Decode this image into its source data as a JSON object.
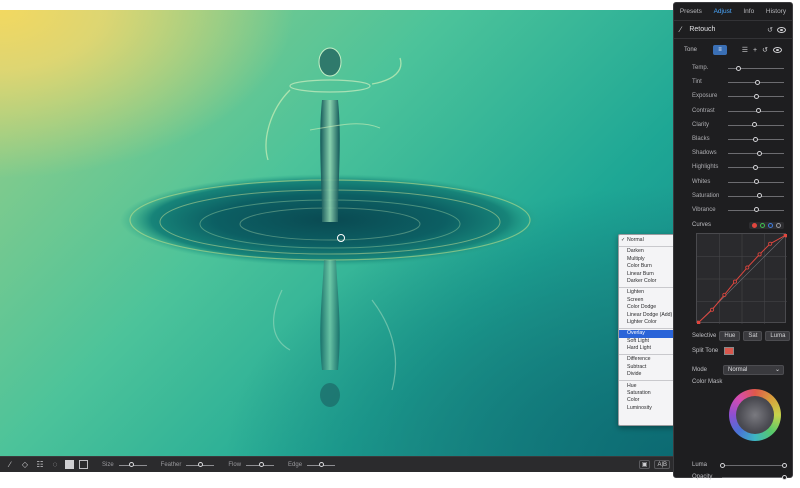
{
  "panel": {
    "tabs": [
      {
        "label": "Presets",
        "active": false
      },
      {
        "label": "Adjust",
        "active": true
      },
      {
        "label": "Info",
        "active": false
      },
      {
        "label": "History",
        "active": false
      }
    ],
    "retouch_title": "Retouch",
    "tone_label": "Tone",
    "sliders": [
      {
        "label": "Temp.",
        "value": 0.18
      },
      {
        "label": "Tint",
        "value": 0.52
      },
      {
        "label": "Exposure",
        "value": 0.5
      },
      {
        "label": "Contrast",
        "value": 0.54
      },
      {
        "label": "Clarity",
        "value": 0.48
      },
      {
        "label": "Blacks",
        "value": 0.49
      },
      {
        "label": "Shadows",
        "value": 0.57
      },
      {
        "label": "Highlights",
        "value": 0.49
      },
      {
        "label": "Whites",
        "value": 0.5
      },
      {
        "label": "Saturation",
        "value": 0.56
      },
      {
        "label": "Vibrance",
        "value": 0.5
      }
    ],
    "curves_label": "Curves",
    "curve_dot_colors": [
      "#e0463e",
      "#3fbf4f",
      "#3f7de0",
      "#9a9aa0"
    ],
    "curve_points": [
      [
        0.0,
        0.0
      ],
      [
        0.16,
        0.15
      ],
      [
        0.3,
        0.32
      ],
      [
        0.42,
        0.47
      ],
      [
        0.56,
        0.63
      ],
      [
        0.7,
        0.78
      ],
      [
        0.82,
        0.9
      ],
      [
        1.0,
        1.0
      ]
    ],
    "selective_label": "Selective",
    "selective_buttons": [
      "Hue",
      "Sat",
      "Luma"
    ],
    "split_tone_label": "Split Tone",
    "split_tone_color": "#d8574d",
    "mode_label": "Mode",
    "mode_value": "Normal",
    "color_mask_label": "Color Mask",
    "luma_label": "Luma",
    "opacity_label": "Opacity"
  },
  "toolbar": {
    "size_label": "Size",
    "feather_label": "Feather",
    "flow_label": "Flow",
    "edge_label": "Edge",
    "size_value": 0.45,
    "feather_value": 0.5,
    "flow_value": 0.55,
    "edge_value": 0.5,
    "ab_label": "A|B"
  },
  "blend_menu": {
    "groups": [
      [
        {
          "label": "Normal",
          "checked": true
        }
      ],
      [
        {
          "label": "Darken"
        },
        {
          "label": "Multiply"
        },
        {
          "label": "Color Burn"
        },
        {
          "label": "Linear Burn"
        },
        {
          "label": "Darker Color"
        }
      ],
      [
        {
          "label": "Lighten"
        },
        {
          "label": "Screen"
        },
        {
          "label": "Color Dodge"
        },
        {
          "label": "Linear Dodge (Add)"
        },
        {
          "label": "Lighter Color"
        }
      ],
      [
        {
          "label": "Overlay",
          "selected": true
        },
        {
          "label": "Soft Light"
        },
        {
          "label": "Hard Light"
        }
      ],
      [
        {
          "label": "Difference"
        },
        {
          "label": "Subtract"
        },
        {
          "label": "Divide"
        }
      ],
      [
        {
          "label": "Hue"
        },
        {
          "label": "Saturation"
        },
        {
          "label": "Color"
        },
        {
          "label": "Luminosity"
        }
      ]
    ]
  },
  "colors": {
    "accent": "#4aa8ff",
    "menu_selection": "#2a64d8",
    "curve_line": "#e0463e"
  }
}
